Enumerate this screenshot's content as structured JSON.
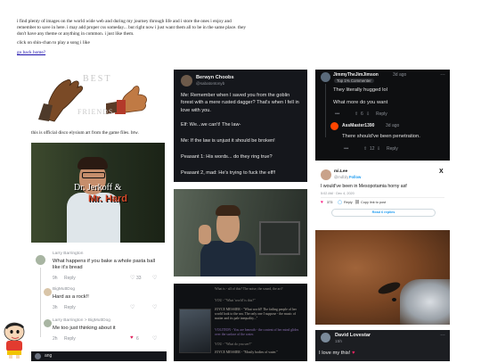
{
  "intro": {
    "paragraph": "i find plenty of images on the world wide web and during my journey through life and i store the ones i enjoy and remember to save in here. i may add proper css someday... but right now i just want them all to be in the same place. they don't have any theme or anything in common. i just like them.",
    "click_text": "click on shin-chan to play a song i like",
    "back_link": "go back home?"
  },
  "best_friends": {
    "word1": "BEST",
    "word2": "FRIENDS",
    "caption": "this is official disco elysium art from the game files. btw."
  },
  "jerkoff": {
    "title1": "Dr. Jerkoff &",
    "title2": "Mr. Hard"
  },
  "reddit_comments": [
    {
      "user": "Larry Barrington",
      "text": "What happens if you bake a whole pasta ball like it's bread",
      "time": "9h",
      "reply": "Reply",
      "votes": "33"
    },
    {
      "user": "BigMuttDog",
      "text": "Hard as a rock!!",
      "time": "3h",
      "reply": "Reply",
      "votes": ""
    },
    {
      "user": "Larry Barrington > BigMuttDog",
      "text": "Me too just thinking about it",
      "time": "2h",
      "reply": "Reply",
      "votes": "6"
    }
  ],
  "bottom_left_card": {
    "user": "ang"
  },
  "goblin_tweet": {
    "name": "Berwyn Choobs",
    "handle": "@sabatontonyb",
    "lines": [
      "Me: Remember when I saved you from the goblin forest with a mere rusted dagger? That's when I fell in love with you.",
      "Elf: We...we can't! The law-",
      "Me: If the law is unjust it should be broken!",
      "Peasant 1: His words... do they ring true?",
      "Peasant 2, mad: He's trying to fuck the elf!!"
    ]
  },
  "game_dialogue": {
    "lines": [
      "What is - all of this? The noise, the sound, the art?",
      "YOU - \"What 'world' is this?\"",
      "JOYCE MESSIER - \"What world? The failing people of her world look to the sea. The only one I suppose - the music of matter and its pale inequality...\"",
      "VOLITION - You are beneath - the content of her mind glides over the surface of the water.",
      "YOU - \"What do you see?\"",
      "JOYCE MESSIER - \"Mostly bodies of water.\""
    ]
  },
  "reddit_thread": {
    "user1": "JimmyTheJimJimson",
    "time1": "3d ago",
    "badge": "Top 1% Commenter",
    "text1a": "They literally hugged lol",
    "text1b": "What more do you want",
    "votes1": "6",
    "reply": "Reply",
    "user2": "AssMaster1390",
    "time2": "3d ago",
    "text2": "There should've been penetration.",
    "votes2": "12"
  },
  "mesopotamia_tweet": {
    "name": "mi.Lee",
    "handle": "@mdl1ly",
    "follow": "Follow",
    "text": "I would've been in Mesopotamia horny asf",
    "timestamp": "5:02 AM · Dec 4, 2020",
    "likes": "373",
    "reply": "Reply",
    "copy": "Copy link to post",
    "read": "Read 6 replies"
  },
  "lovestar": {
    "name": "David Lovestar",
    "time": "15h",
    "text": "I love my this!"
  },
  "colors": {
    "link": "#1a0dab",
    "reddit_orange": "#ff4500",
    "dark_card": "#15171c",
    "twitter_blue": "#1d9bf0"
  }
}
